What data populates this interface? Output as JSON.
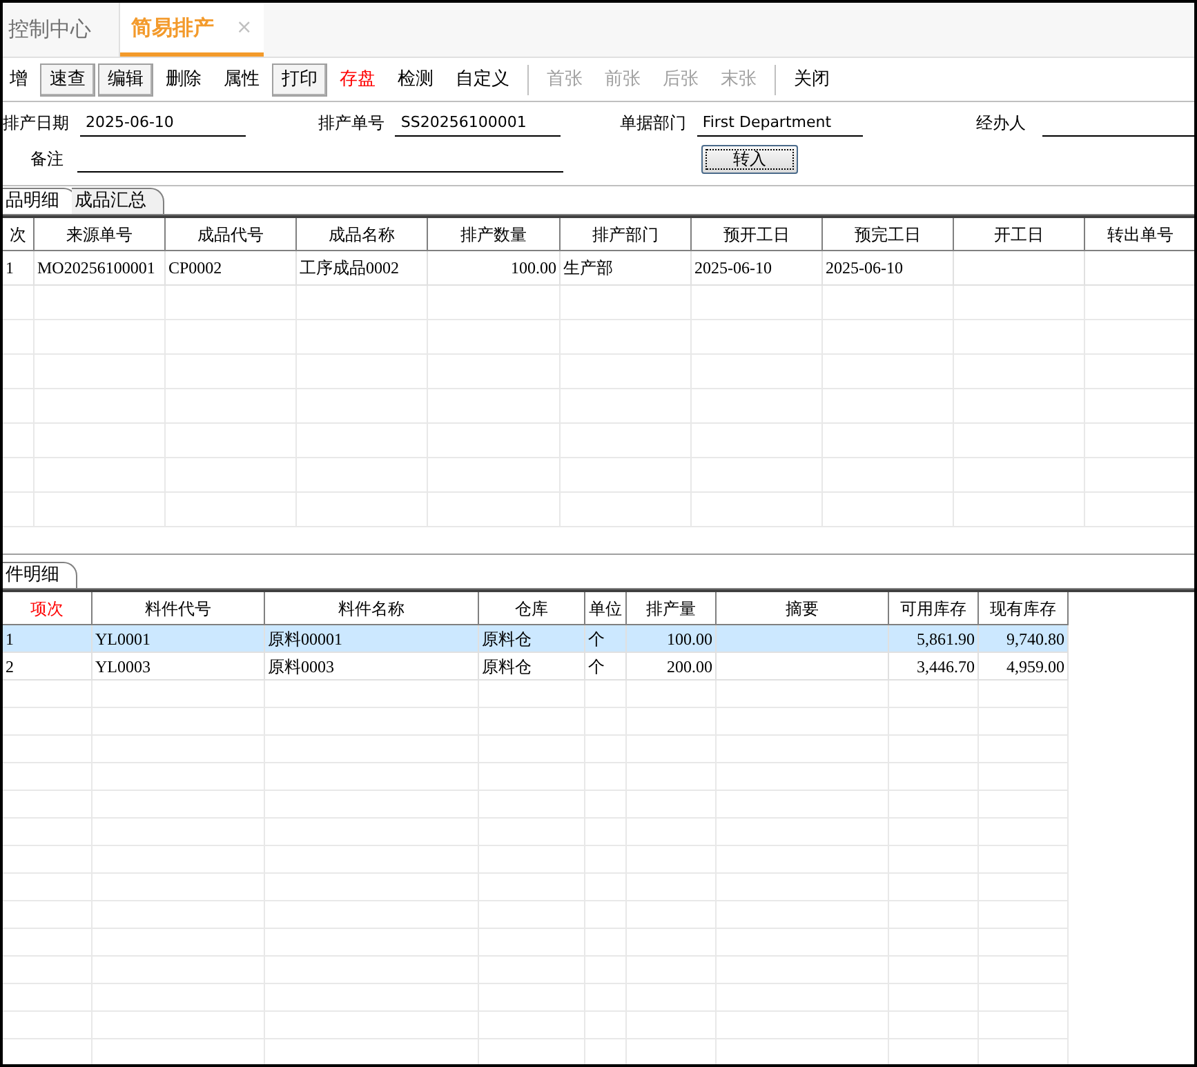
{
  "tabs": [
    {
      "label": "控制中心",
      "selected": false
    },
    {
      "label": "简易排产",
      "selected": true,
      "close": "×"
    }
  ],
  "toolbar": [
    [
      {
        "label": "增",
        "kind": "plain",
        "disabled": false
      },
      {
        "label": "速查",
        "kind": "framed",
        "disabled": false
      },
      {
        "label": "编辑",
        "kind": "framed",
        "disabled": false
      },
      {
        "label": "删除",
        "kind": "plain",
        "disabled": false
      },
      {
        "label": "属性",
        "kind": "plain",
        "disabled": false
      },
      {
        "label": "打印",
        "kind": "framed",
        "disabled": false
      },
      {
        "label": "存盘",
        "kind": "alert",
        "disabled": false
      },
      {
        "label": "检测",
        "kind": "plain",
        "disabled": false
      },
      {
        "label": "自定义",
        "kind": "plain",
        "disabled": false
      }
    ],
    [
      {
        "label": "首张",
        "kind": "plain",
        "disabled": true
      },
      {
        "label": "前张",
        "kind": "plain",
        "disabled": true
      },
      {
        "label": "后张",
        "kind": "plain",
        "disabled": true
      },
      {
        "label": "末张",
        "kind": "plain",
        "disabled": true
      }
    ],
    [
      {
        "label": "关闭",
        "kind": "plain",
        "disabled": false
      }
    ]
  ],
  "form": {
    "date": {
      "label": "排产日期",
      "value": "2025-06-10"
    },
    "number": {
      "label": "排产单号",
      "value": "SS20256100001"
    },
    "department": {
      "label": "单据部门",
      "value": "First Department"
    },
    "handler": {
      "label": "经办人"
    },
    "note": {
      "label": "备注"
    },
    "transfer_button": "转入"
  },
  "product_tabs": [
    {
      "label": "品明细",
      "selected": true
    },
    {
      "label": "成品汇总",
      "selected": false
    }
  ],
  "product_table": {
    "columns": [
      "次",
      "来源单号",
      "成品代号",
      "成品名称",
      "排产数量",
      "排产部门",
      "预开工日",
      "预完工日",
      "开工日",
      "转出单号"
    ],
    "rows": [
      {
        "selected": false,
        "cells": [
          "1",
          "MO20256100001",
          "CP0002",
          "工序成品0002",
          "100.00",
          "生产部",
          "2025-06-10",
          "2025-06-10",
          "",
          ""
        ]
      }
    ]
  },
  "material_tabs": [
    {
      "label": "件明细",
      "selected": true
    }
  ],
  "material_table": {
    "columns": [
      "项次",
      "料件代号",
      "料件名称",
      "仓库",
      "单位",
      "排产量",
      "摘要",
      "可用库存",
      "现有库存"
    ],
    "rows": [
      {
        "selected": true,
        "cells": [
          "1",
          "YL0001",
          "原料00001",
          "原料仓",
          "个",
          "100.00",
          "",
          "5,861.90",
          "9,740.80"
        ]
      },
      {
        "selected": false,
        "cells": [
          "2",
          "YL0003",
          "原料0003",
          "原料仓",
          "个",
          "200.00",
          "",
          "3,446.70",
          "4,959.00"
        ]
      }
    ]
  }
}
